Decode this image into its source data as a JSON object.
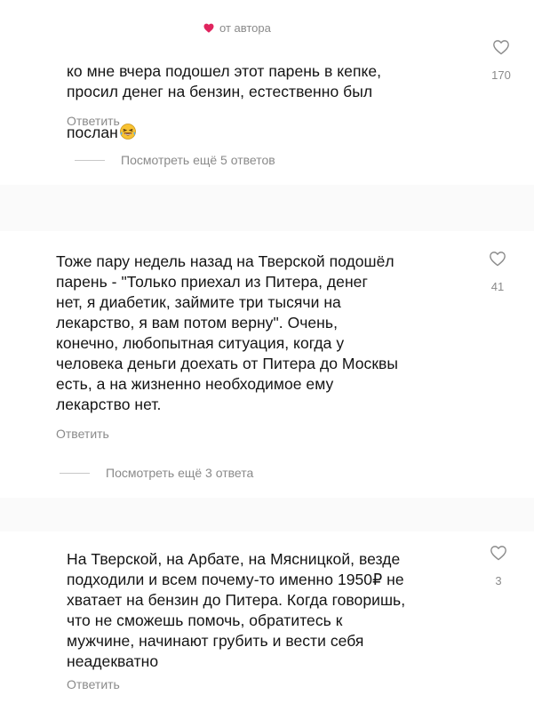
{
  "comments": [
    {
      "author_tag": "от автора",
      "text": "ко мне вчера подошел этот парень в кепке,\nпросил денег на бензин, естественно был\nпослан",
      "reply_label": "Ответить",
      "more_replies": "Посмотреть ещё 5 ответов",
      "likes": "170",
      "emoji": "laughing-tears-emoji"
    },
    {
      "text": "Тоже пару недель назад на Тверской подошёл\nпарень - \"Только приехал из Питера, денег\nнет, я диабетик, займите три тысячи на\nлекарство, я вам потом верну\". Очень,\nконечно, любопытная ситуация, когда у\nчеловека деньги доехать от Питера до Москвы\nесть, а на жизненно необходимое ему\nлекарство нет.",
      "reply_label": "Ответить",
      "more_replies": "Посмотреть ещё 3 ответа",
      "likes": "41"
    },
    {
      "text": "На Тверской, на Арбате, на Мясницкой, везде\nподходили и всем почему-то именно 1950₽ не\nхватает на бензин до Питера. Когда говоришь,\nчто не сможешь помочь, обратитесь к\nмужчине, начинают грубить и вести себя\nнеадекватно",
      "reply_label": "Ответить",
      "likes": "3"
    }
  ],
  "colors": {
    "heart_author": "#e0245e",
    "secondary_text": "#8a8a8a",
    "separator_band": "#fafafa"
  }
}
